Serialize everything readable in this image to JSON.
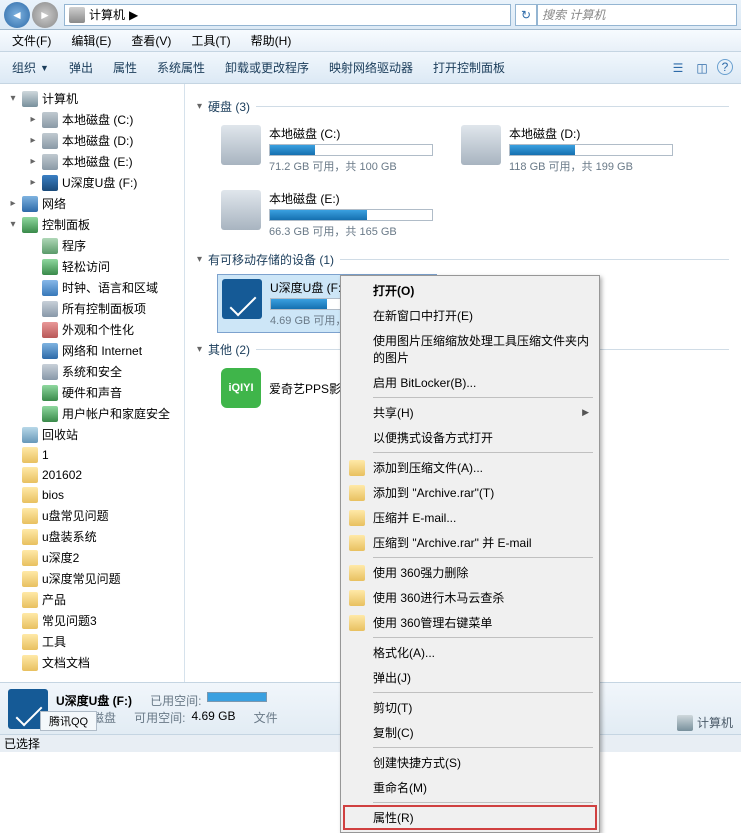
{
  "titlebar": {
    "breadcrumb": "计算机",
    "breadcrumb_sep": "▶",
    "search_placeholder": "搜索 计算机"
  },
  "menubar": {
    "file": "文件(F)",
    "edit": "编辑(E)",
    "view": "查看(V)",
    "tools": "工具(T)",
    "help": "帮助(H)"
  },
  "toolbar": {
    "organize": "组织",
    "eject": "弹出",
    "properties": "属性",
    "system_properties": "系统属性",
    "uninstall": "卸载或更改程序",
    "map_drive": "映射网络驱动器",
    "control_panel": "打开控制面板"
  },
  "sidebar": {
    "items": [
      {
        "label": "计算机",
        "icon": "ic-computer",
        "indent": 8,
        "arrow": "▾"
      },
      {
        "label": "本地磁盘 (C:)",
        "icon": "ic-drive",
        "indent": 28,
        "arrow": "▸"
      },
      {
        "label": "本地磁盘 (D:)",
        "icon": "ic-drive",
        "indent": 28,
        "arrow": "▸"
      },
      {
        "label": "本地磁盘 (E:)",
        "icon": "ic-drive",
        "indent": 28,
        "arrow": "▸"
      },
      {
        "label": "U深度U盘 (F:)",
        "icon": "ic-usb",
        "indent": 28,
        "arrow": "▸"
      },
      {
        "label": "网络",
        "icon": "ic-network",
        "indent": 8,
        "arrow": "▸"
      },
      {
        "label": "控制面板",
        "icon": "ic-cpanel",
        "indent": 8,
        "arrow": "▾"
      },
      {
        "label": "程序",
        "icon": "ic-prog",
        "indent": 28,
        "arrow": ""
      },
      {
        "label": "轻松访问",
        "icon": "ic-cpanel",
        "indent": 28,
        "arrow": ""
      },
      {
        "label": "时钟、语言和区域",
        "icon": "ic-blue",
        "indent": 28,
        "arrow": ""
      },
      {
        "label": "所有控制面板项",
        "icon": "ic-gear",
        "indent": 28,
        "arrow": ""
      },
      {
        "label": "外观和个性化",
        "icon": "ic-red",
        "indent": 28,
        "arrow": ""
      },
      {
        "label": "网络和 Internet",
        "icon": "ic-network",
        "indent": 28,
        "arrow": ""
      },
      {
        "label": "系统和安全",
        "icon": "ic-gear",
        "indent": 28,
        "arrow": ""
      },
      {
        "label": "硬件和声音",
        "icon": "ic-cpanel",
        "indent": 28,
        "arrow": ""
      },
      {
        "label": "用户帐户和家庭安全",
        "icon": "ic-cpanel",
        "indent": 28,
        "arrow": ""
      },
      {
        "label": "回收站",
        "icon": "ic-recycle",
        "indent": 8,
        "arrow": ""
      },
      {
        "label": "1",
        "icon": "ic-folder",
        "indent": 8,
        "arrow": ""
      },
      {
        "label": "201602",
        "icon": "ic-folder",
        "indent": 8,
        "arrow": ""
      },
      {
        "label": "bios",
        "icon": "ic-folder",
        "indent": 8,
        "arrow": ""
      },
      {
        "label": "u盘常见问题",
        "icon": "ic-folder",
        "indent": 8,
        "arrow": ""
      },
      {
        "label": "u盘装系统",
        "icon": "ic-folder",
        "indent": 8,
        "arrow": ""
      },
      {
        "label": "u深度2",
        "icon": "ic-folder",
        "indent": 8,
        "arrow": ""
      },
      {
        "label": "u深度常见问题",
        "icon": "ic-folder",
        "indent": 8,
        "arrow": ""
      },
      {
        "label": "产品",
        "icon": "ic-folder",
        "indent": 8,
        "arrow": ""
      },
      {
        "label": "常见问题3",
        "icon": "ic-folder",
        "indent": 8,
        "arrow": ""
      },
      {
        "label": "工具",
        "icon": "ic-folder",
        "indent": 8,
        "arrow": ""
      },
      {
        "label": "文档文档",
        "icon": "ic-folder",
        "indent": 8,
        "arrow": ""
      }
    ]
  },
  "content": {
    "group_hdd": "硬盘 (3)",
    "group_removable": "有可移动存储的设备 (1)",
    "group_other": "其他 (2)",
    "drives": {
      "c": {
        "name": "本地磁盘 (C:)",
        "stats": "71.2 GB 可用，共 100 GB",
        "fill": 28
      },
      "d": {
        "name": "本地磁盘 (D:)",
        "stats": "118 GB 可用，共 199 GB",
        "fill": 40
      },
      "e": {
        "name": "本地磁盘 (E:)",
        "stats": "66.3 GB 可用，共 165 GB",
        "fill": 60
      },
      "f": {
        "name": "U深度U盘 (F:)",
        "stats": "4.69 GB 可用，",
        "fill": 35
      }
    },
    "other_app": "爱奇艺PPS影音"
  },
  "context_menu": {
    "items": [
      {
        "label": "打开(O)",
        "bold": true
      },
      {
        "label": "在新窗口中打开(E)"
      },
      {
        "label": "使用图片压缩缩放处理工具压缩文件夹内的图片"
      },
      {
        "label": "启用 BitLocker(B)..."
      },
      {
        "sep": true
      },
      {
        "label": "共享(H)",
        "sub": true
      },
      {
        "label": "以便携式设备方式打开"
      },
      {
        "sep": true
      },
      {
        "label": "添加到压缩文件(A)...",
        "icon": "ic-folder"
      },
      {
        "label": "添加到 \"Archive.rar\"(T)",
        "icon": "ic-folder"
      },
      {
        "label": "压缩并 E-mail...",
        "icon": "ic-folder"
      },
      {
        "label": "压缩到 \"Archive.rar\" 并 E-mail",
        "icon": "ic-folder"
      },
      {
        "sep": true
      },
      {
        "label": "使用 360强力删除",
        "icon": "ic-recycle"
      },
      {
        "label": "使用 360进行木马云查杀",
        "icon": "ic-cpanel"
      },
      {
        "label": "使用 360管理右键菜单",
        "icon": "ic-cpanel"
      },
      {
        "sep": true
      },
      {
        "label": "格式化(A)..."
      },
      {
        "label": "弹出(J)"
      },
      {
        "sep": true
      },
      {
        "label": "剪切(T)"
      },
      {
        "label": "复制(C)"
      },
      {
        "sep": true
      },
      {
        "label": "创建快捷方式(S)"
      },
      {
        "label": "重命名(M)"
      },
      {
        "sep": true
      },
      {
        "label": "属性(R)",
        "highlight": true
      }
    ]
  },
  "details": {
    "title": "U深度U盘 (F:)",
    "type": "可移动磁盘",
    "used_label": "已用空间:",
    "free_label": "可用空间:",
    "free_value": "4.69 GB",
    "fs_label": "文件"
  },
  "statusbar": {
    "left": "已选择",
    "task_app": "腾讯QQ",
    "task_right": "计算机"
  }
}
